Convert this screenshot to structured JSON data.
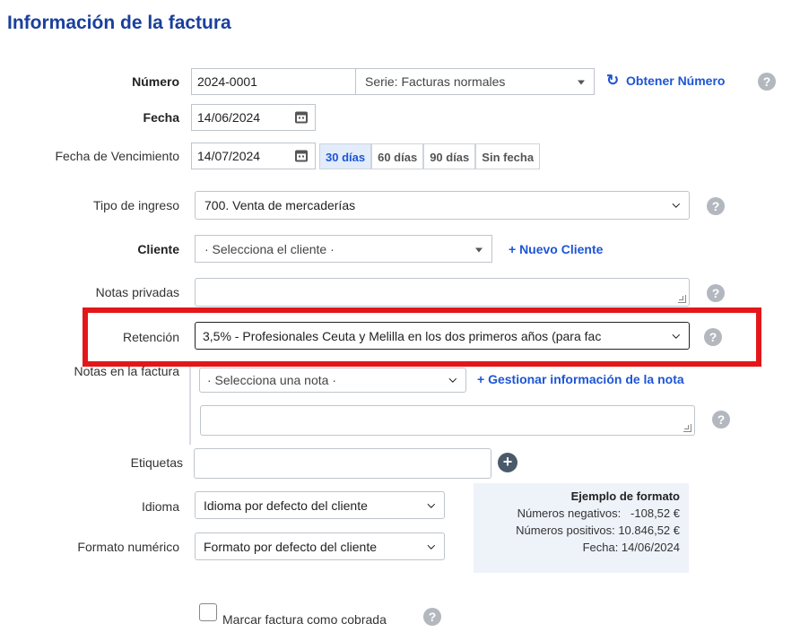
{
  "page": {
    "title": "Información de la factura"
  },
  "numero": {
    "label": "Número",
    "value": "2024-0001",
    "serie": "Serie: Facturas normales",
    "obtener_label": "Obtener Número"
  },
  "fecha": {
    "label": "Fecha",
    "value": "14/06/2024"
  },
  "vencimiento": {
    "label": "Fecha de Vencimiento",
    "value": "14/07/2024",
    "options": [
      "30 días",
      "60 días",
      "90 días",
      "Sin fecha"
    ],
    "active": "30 días"
  },
  "tipo_ingreso": {
    "label": "Tipo de ingreso",
    "value": "700. Venta de mercaderías"
  },
  "cliente": {
    "label": "Cliente",
    "placeholder": "· Selecciona el cliente ·",
    "nuevo_label": "+ Nuevo Cliente"
  },
  "notas_privadas": {
    "label": "Notas privadas",
    "value": ""
  },
  "retencion": {
    "label": "Retención",
    "value": "3,5% - Profesionales Ceuta y Melilla en los dos primeros años (para fac"
  },
  "notas_factura": {
    "label": "Notas en la factura",
    "placeholder": "· Selecciona una nota ·",
    "gestionar_label": "+ Gestionar información de la nota",
    "text": ""
  },
  "etiquetas": {
    "label": "Etiquetas",
    "value": ""
  },
  "idioma": {
    "label": "Idioma",
    "value": "Idioma por defecto del cliente"
  },
  "formato": {
    "label": "Formato numérico",
    "value": "Formato por defecto del cliente"
  },
  "ejemplo": {
    "title": "Ejemplo de formato",
    "negativos": "Números negativos:   -108,52 €",
    "positivos": "Números positivos: 10.846,52 €",
    "fecha": "Fecha: 14/06/2024"
  },
  "cobrada": {
    "label": "Marcar factura como cobrada",
    "checked": false
  },
  "icons": {
    "help": "help-circle-icon",
    "refresh": "refresh-icon",
    "calendar": "calendar-icon",
    "add": "plus-circle-icon",
    "dropdown": "chevron-down-icon"
  },
  "colors": {
    "title": "#1a3f9c",
    "link": "#1d55d4",
    "highlight": "#e3171a",
    "active_segment_bg": "#e2ecfb"
  }
}
